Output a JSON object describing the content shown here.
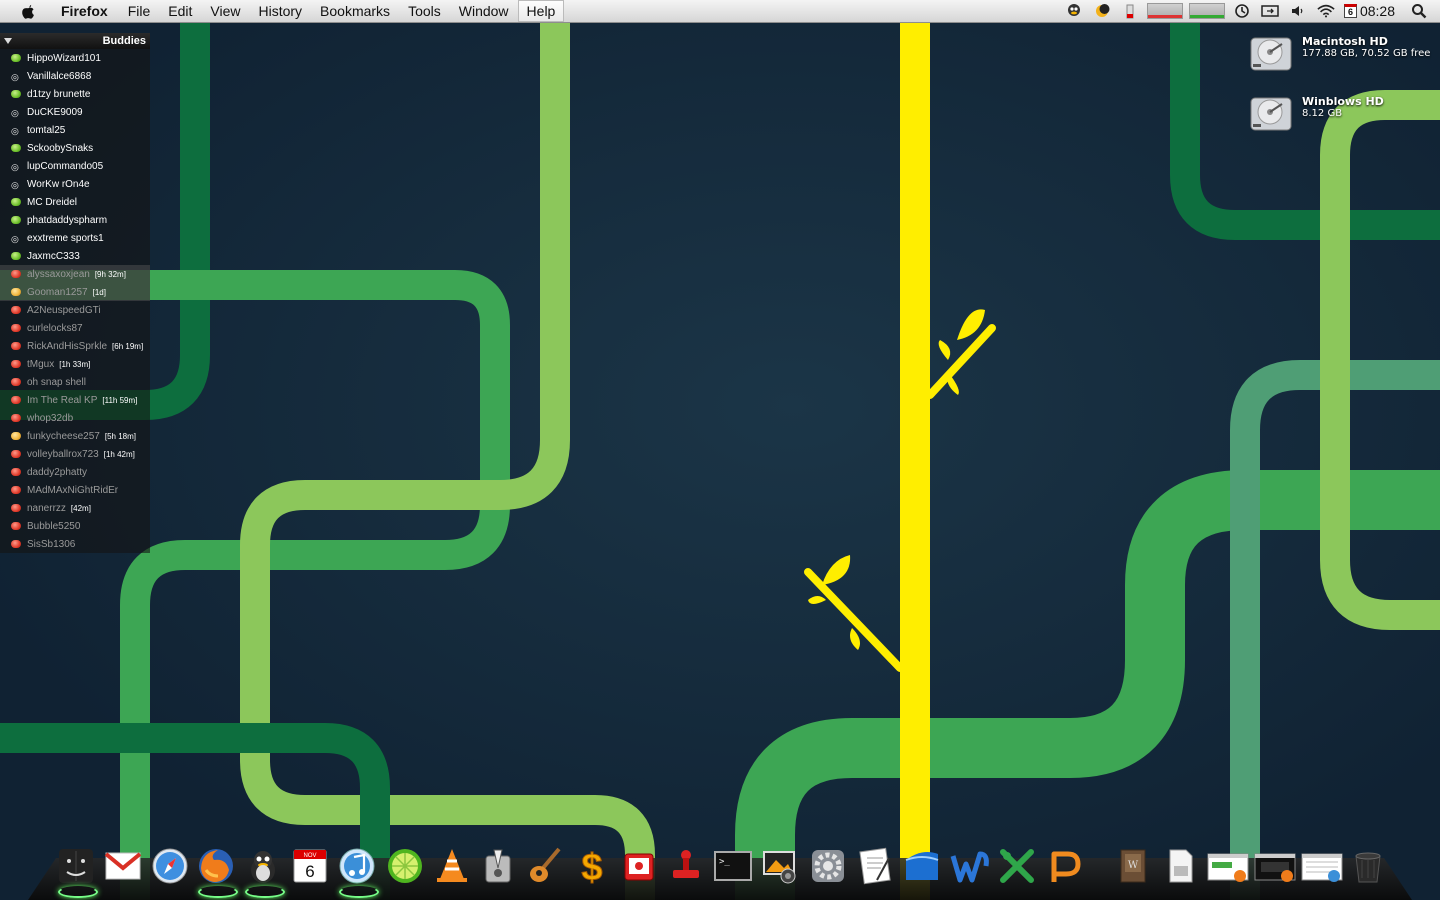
{
  "menubar": {
    "app": "Firefox",
    "items": [
      "File",
      "Edit",
      "View",
      "History",
      "Bookmarks",
      "Tools",
      "Window",
      "Help"
    ],
    "active": "Help",
    "calendar_day": "6",
    "clock": "08:28"
  },
  "buddies": {
    "title": "Buddies",
    "items": [
      {
        "name": "HippoWizard101",
        "status": "green",
        "idle": ""
      },
      {
        "name": "Vanillalce6868",
        "status": "mobile",
        "idle": ""
      },
      {
        "name": "d1tzy   brunette",
        "status": "green",
        "idle": ""
      },
      {
        "name": "DuCKE9009",
        "status": "mobile",
        "idle": ""
      },
      {
        "name": "tomtal25",
        "status": "mobile",
        "idle": ""
      },
      {
        "name": "SckoobySnaks",
        "status": "green",
        "idle": ""
      },
      {
        "name": "lupCommando05",
        "status": "mobile",
        "idle": ""
      },
      {
        "name": "WorKw rOn4e",
        "status": "mobile",
        "idle": ""
      },
      {
        "name": "MC Dreidel",
        "status": "green",
        "idle": ""
      },
      {
        "name": "phatdaddyspharm",
        "status": "green",
        "idle": ""
      },
      {
        "name": "exxtreme sports1",
        "status": "mobile",
        "idle": ""
      },
      {
        "name": "JaxmcC333",
        "status": "green",
        "idle": ""
      },
      {
        "name": "alyssaxoxjean",
        "status": "red",
        "idle": "[9h 32m]",
        "away": true,
        "row": "idle"
      },
      {
        "name": "Gooman1257",
        "status": "yellow",
        "idle": "[1d]",
        "away": true,
        "row": "idle"
      },
      {
        "name": "A2NeuspeedGTi",
        "status": "red",
        "idle": "",
        "away": true
      },
      {
        "name": "curlelocks87",
        "status": "red",
        "idle": "",
        "away": true
      },
      {
        "name": "RickAndHisSprkle",
        "status": "red",
        "idle": "[6h 19m]",
        "away": true
      },
      {
        "name": "tMgux",
        "status": "red",
        "idle": "[1h 33m]",
        "away": true
      },
      {
        "name": "oh snap shell",
        "status": "red",
        "idle": "",
        "away": true
      },
      {
        "name": "Im The Real KP",
        "status": "red",
        "idle": "[11h 59m]",
        "away": true
      },
      {
        "name": "whop32db",
        "status": "red",
        "idle": "",
        "away": true
      },
      {
        "name": "funkycheese257",
        "status": "yellow",
        "idle": "[5h 18m]",
        "away": true
      },
      {
        "name": "volleyballrox723",
        "status": "red",
        "idle": "[1h 42m]",
        "away": true
      },
      {
        "name": "daddy2phatty",
        "status": "red",
        "idle": "",
        "away": true
      },
      {
        "name": "MAdMAxNiGhtRidEr",
        "status": "red",
        "idle": "",
        "away": true
      },
      {
        "name": "nanerrzz",
        "status": "red",
        "idle": "[42m]",
        "away": true
      },
      {
        "name": "Bubble5250",
        "status": "red",
        "idle": "",
        "away": true
      },
      {
        "name": "SisSb1306",
        "status": "red",
        "idle": "",
        "away": true
      }
    ]
  },
  "drives": [
    {
      "name": "Macintosh HD",
      "info": "177.88 GB, 70.52 GB free"
    },
    {
      "name": "Winblows HD",
      "info": "8.12 GB"
    }
  ],
  "dock": {
    "calendar_month": "NOV",
    "calendar_day": "6",
    "items": [
      {
        "icon": "finder-icon",
        "running": true
      },
      {
        "icon": "gmail-icon",
        "running": false
      },
      {
        "icon": "safari-icon",
        "running": false
      },
      {
        "icon": "firefox-icon",
        "running": true
      },
      {
        "icon": "adium-icon",
        "running": true
      },
      {
        "icon": "ical-icon",
        "running": false
      },
      {
        "icon": "itunes-icon",
        "running": true
      },
      {
        "icon": "limewire-icon",
        "running": false
      },
      {
        "icon": "vlc-icon",
        "running": false
      },
      {
        "icon": "automator-icon",
        "running": false
      },
      {
        "icon": "garageband-icon",
        "running": false
      },
      {
        "icon": "money-icon",
        "running": false
      },
      {
        "icon": "photo-booth-icon",
        "running": false
      },
      {
        "icon": "stamp-icon",
        "running": false
      },
      {
        "icon": "terminal-icon",
        "running": false
      },
      {
        "icon": "iphoto-icon",
        "running": false
      },
      {
        "icon": "system-preferences-icon",
        "running": false
      },
      {
        "icon": "textedit-icon",
        "running": false
      },
      {
        "icon": "mac-finder-blue-icon",
        "running": false
      },
      {
        "icon": "word-icon",
        "running": false
      },
      {
        "icon": "excel-icon",
        "running": false
      },
      {
        "icon": "powerpoint-icon",
        "running": false
      },
      {
        "icon": "documents-stack-icon",
        "running": false
      },
      {
        "icon": "downloads-stack-icon",
        "running": false
      },
      {
        "icon": "minimized-window-1-icon",
        "running": false
      },
      {
        "icon": "minimized-window-2-icon",
        "running": false
      },
      {
        "icon": "minimized-window-3-icon",
        "running": false
      },
      {
        "icon": "trash-icon",
        "running": false
      }
    ]
  },
  "colors": {
    "background": "#13283a",
    "stripe_dark": "#0d6e3e",
    "stripe_mid": "#3da654",
    "stripe_light": "#8cc75b",
    "stripe_teal": "#4f9e75",
    "yellow": "#ffee00",
    "away_text": "#9a9a9a",
    "dock_lamp": "#77ff88"
  }
}
